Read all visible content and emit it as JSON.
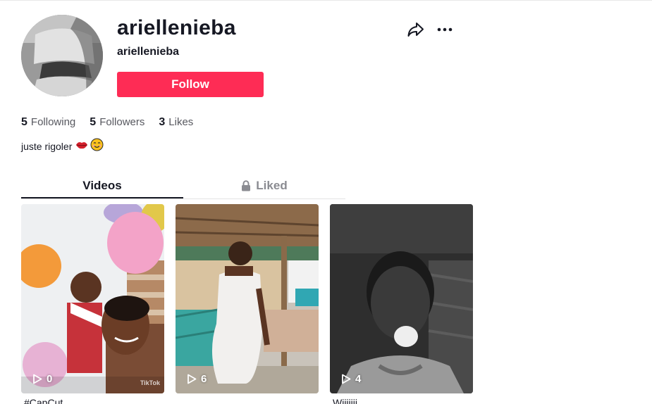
{
  "profile": {
    "title": "ariellenieba",
    "subtitle": "ariellenieba",
    "follow_label": "Follow",
    "bio": "juste rigoler",
    "bio_emojis": [
      "lips-emoji",
      "smiling-face-emoji"
    ]
  },
  "header_actions": {
    "share_icon": "share-icon",
    "more_icon": "more-dots-icon"
  },
  "stats": [
    {
      "number": "5",
      "label": "Following"
    },
    {
      "number": "5",
      "label": "Followers"
    },
    {
      "number": "3",
      "label": "Likes"
    }
  ],
  "tabs": [
    {
      "label": "Videos",
      "active": true
    },
    {
      "label": "Liked",
      "active": false,
      "icon": "lock-icon"
    }
  ],
  "videos": [
    {
      "views": "0",
      "caption": "#CapCut",
      "watermark": "TikTok"
    },
    {
      "views": "6",
      "caption": ""
    },
    {
      "views": "4",
      "caption": "Wiiiiiii"
    }
  ],
  "colors": {
    "accent": "#fe2c55",
    "text": "#161823",
    "secondary_text": "#57585f",
    "inactive_tab": "#8a8b91"
  }
}
